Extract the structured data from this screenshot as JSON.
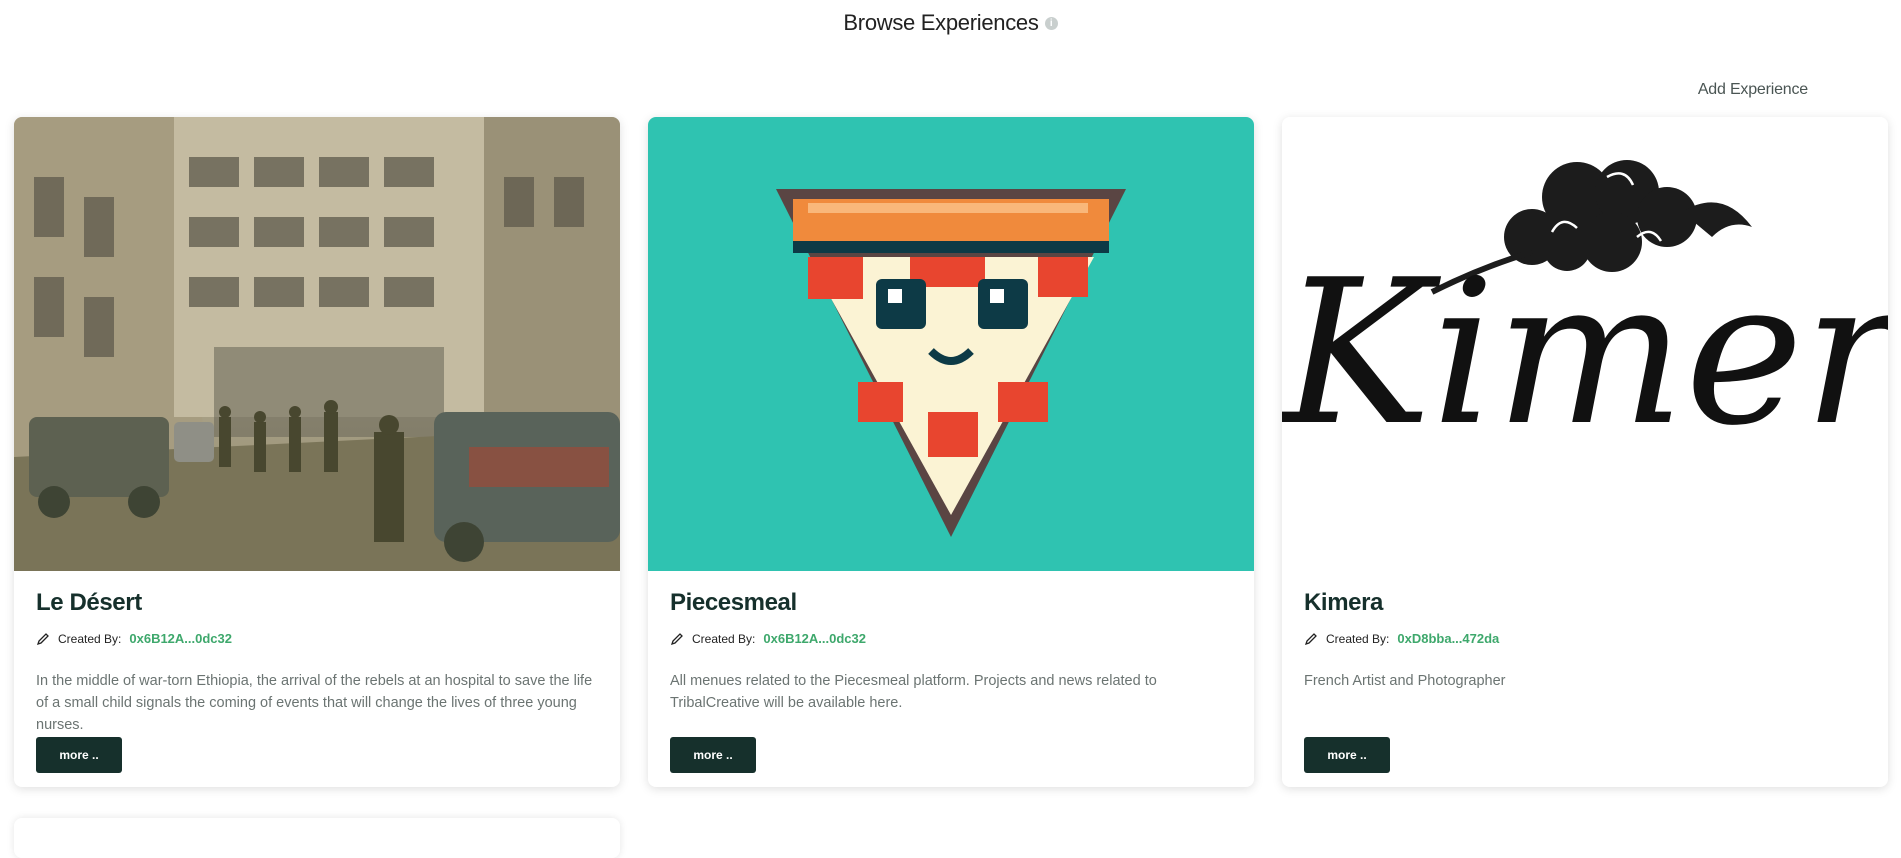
{
  "header": {
    "title": "Browse Experiences",
    "info_icon": "info-icon"
  },
  "toolbar": {
    "add_label": "Add Experience"
  },
  "cards": [
    {
      "title": "Le Désert",
      "created_by_label": "Created By:",
      "creator": "0x6B12A...0dc32",
      "description": "In the middle of war-torn Ethiopia, the arrival of the rebels at an hospital to save the life of a small child signals the coming of events that will change the lives of three young nurses.",
      "more_label": "more ..",
      "image": "war-scene-illustration"
    },
    {
      "title": "Piecesmeal",
      "created_by_label": "Created By:",
      "creator": "0x6B12A...0dc32",
      "description": "All menues related to the Piecesmeal platform. Projects and news related to TribalCreative will be available here.",
      "more_label": "more ..",
      "image": "pixel-pizza-slice"
    },
    {
      "title": "Kimera",
      "created_by_label": "Created By:",
      "creator": "0xD8bba...472da",
      "description": "French Artist and Photographer",
      "more_label": "more ..",
      "image": "kimera-logo",
      "logo_text": "Kimera"
    }
  ],
  "colors": {
    "accent": "#3ea86c",
    "button": "#16302c",
    "pizza_bg": "#2fc3b1"
  }
}
